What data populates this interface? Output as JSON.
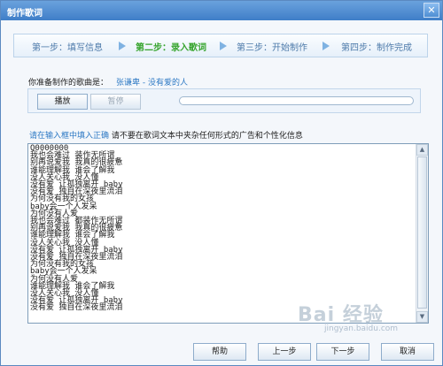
{
  "window": {
    "title": "制作歌词",
    "close_glyph": "✕"
  },
  "steps": [
    {
      "label": "第一步：填写信息"
    },
    {
      "label": "第二步：录入歌词"
    },
    {
      "label": "第三步：开始制作"
    },
    {
      "label": "第四步：制作完成"
    }
  ],
  "song": {
    "label": "你准备制作的歌曲是：",
    "value": "张谦卑 - 没有爱的人"
  },
  "player": {
    "play_label": "播放",
    "pause_label": "暂停"
  },
  "info": {
    "highlight": "请在输入框中填入正确",
    "rest": "请不要在歌词文本中夹杂任何形式的广告和个性化信息"
  },
  "lyrics": [
    "Q0000000",
    "我也会难过  装作无所谓",
    "别再说爱我 我真的很疲惫",
    "谁能理解我 谁会了解我",
    "没人关心我 没人懂",
    "没有爱 让孤独离开 baby",
    "没有爱 独自在深夜里流泪",
    "为何没有我的女孩",
    "baby会一个人发呆",
    "为何没有人爱",
    "我也会难过  都装作无所谓",
    "别再说爱我 我真的很疲惫",
    "谁能理解我 谁会了解我",
    "没人关心我 没人懂",
    "没有爱 让孤独离开 baby",
    "没有爱 独自在深夜里流泪",
    "为何没有我的女孩",
    "baby会一个人发呆",
    "为何没有人爱",
    "谁能理解我 谁会了解我",
    "没人关心我 没人懂",
    "没有爱 让孤独离开 baby",
    "没有爱 独自在深夜里流泪"
  ],
  "scroll": {
    "up_glyph": "▲",
    "down_glyph": "▼"
  },
  "footer": {
    "help_label": "帮助",
    "prev_label": "上一步",
    "next_label": "下一步",
    "cancel_label": "取消"
  },
  "watermark": {
    "text": "Bai 经验",
    "url": "jingyan.baidu.com"
  }
}
